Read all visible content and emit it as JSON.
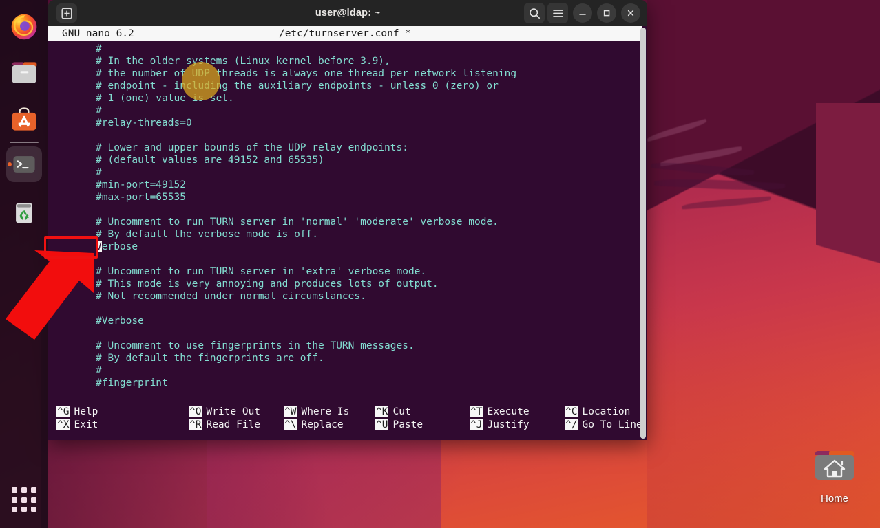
{
  "window": {
    "title": "user@ldap: ~",
    "newtab_icon": "new-tab-icon",
    "search_icon": "search-icon",
    "menu_icon": "hamburger-menu-icon",
    "minimize_icon": "minimize-icon",
    "maximize_icon": "maximize-icon",
    "close_icon": "close-icon"
  },
  "nano": {
    "version_label": "GNU nano 6.2",
    "filename": "/etc/turnserver.conf *",
    "lines": [
      "#",
      "# In the older systems (Linux kernel before 3.9),",
      "# the number of UDP threads is always one thread per network listening",
      "# endpoint - including the auxiliary endpoints - unless 0 (zero) or",
      "# 1 (one) value is set.",
      "#",
      "#relay-threads=0",
      "",
      "# Lower and upper bounds of the UDP relay endpoints:",
      "# (default values are 49152 and 65535)",
      "#",
      "#min-port=49152",
      "#max-port=65535",
      "",
      "# Uncomment to run TURN server in 'normal' 'moderate' verbose mode.",
      "# By default the verbose mode is off.",
      "Verbose",
      "",
      "# Uncomment to run TURN server in 'extra' verbose mode.",
      "# This mode is very annoying and produces lots of output.",
      "# Not recommended under normal circumstances.",
      "",
      "#Verbose",
      "",
      "# Uncomment to use fingerprints in the TURN messages.",
      "# By default the fingerprints are off.",
      "#",
      "#fingerprint"
    ],
    "cursor_line_index": 16,
    "cursor_char": "V",
    "shortcuts": [
      {
        "key": "^G",
        "label": "Help",
        "key2": "^X",
        "label2": "Exit"
      },
      {
        "key": "^O",
        "label": "Write Out",
        "key2": "^R",
        "label2": "Read File"
      },
      {
        "key": "^W",
        "label": "Where Is",
        "key2": "^\\",
        "label2": "Replace"
      },
      {
        "key": "^K",
        "label": "Cut",
        "key2": "^U",
        "label2": "Paste"
      },
      {
        "key": "^T",
        "label": "Execute",
        "key2": "^J",
        "label2": "Justify"
      },
      {
        "key": "^C",
        "label": "Location",
        "key2": "^/",
        "label2": "Go To Line"
      }
    ]
  },
  "dock": {
    "items": [
      {
        "name": "firefox",
        "icon": "firefox-icon",
        "active": false
      },
      {
        "name": "files",
        "icon": "files-folder-icon",
        "active": false
      },
      {
        "name": "ubuntu-software",
        "icon": "ubuntu-software-icon",
        "active": false
      },
      {
        "name": "terminal",
        "icon": "terminal-icon",
        "active": true
      },
      {
        "name": "trash",
        "icon": "trash-icon",
        "active": false
      }
    ],
    "show_applications_label": "Show Applications"
  },
  "desktop": {
    "home_icon_label": "Home",
    "home_icon": "home-folder-icon"
  },
  "annotations": {
    "click_highlight": "mouse-click-highlight",
    "red_box_target": "Verbose",
    "red_arrow": "pointer-arrow"
  },
  "colors": {
    "terminal_bg": "#300a30",
    "terminal_fg": "#82dcd0",
    "nano_bar_bg": "#f7f7f7",
    "annotation_red": "#ef1111",
    "click_amber": "#deaa1e",
    "accent_orange": "#e8622a"
  }
}
